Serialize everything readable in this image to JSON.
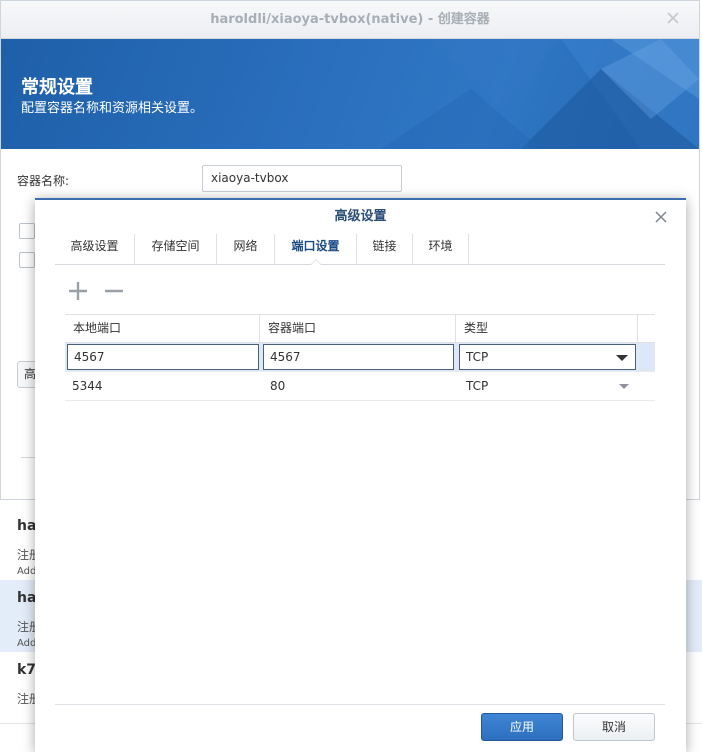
{
  "window": {
    "title": "haroldli/xiaoya-tvbox(native) - 创建容器",
    "banner_title": "常规设置",
    "banner_subtitle": "配置容器名称和资源相关设置。",
    "container_name_label": "容器名称:",
    "container_name_value": "xiaoya-tvbox",
    "peek_button_glyph": "高"
  },
  "background_list": [
    {
      "title": "ha",
      "sub": "注册",
      "addr": "Add"
    },
    {
      "title": "ha",
      "sub": "注册",
      "addr": "Add"
    },
    {
      "title": "k7",
      "sub": "注册",
      "addr": ""
    }
  ],
  "dialog": {
    "title": "高级设置",
    "tabs": [
      "高级设置",
      "存储空间",
      "网络",
      "端口设置",
      "链接",
      "环境"
    ],
    "active_tab": "端口设置",
    "columns": [
      "本地端口",
      "容器端口",
      "类型"
    ],
    "rows": [
      {
        "local": "4567",
        "container": "4567",
        "type": "TCP"
      },
      {
        "local": "5344",
        "container": "80",
        "type": "TCP"
      }
    ],
    "apply_label": "应用",
    "cancel_label": "取消"
  },
  "icons": {
    "close": "close-icon",
    "add": "plus-icon",
    "remove": "minus-icon",
    "dropdown": "chevron-down-icon"
  },
  "colors": {
    "banner": "#2a6fbd",
    "primary_button": "#2c6fbe",
    "selected_row": "#dce8f7"
  }
}
